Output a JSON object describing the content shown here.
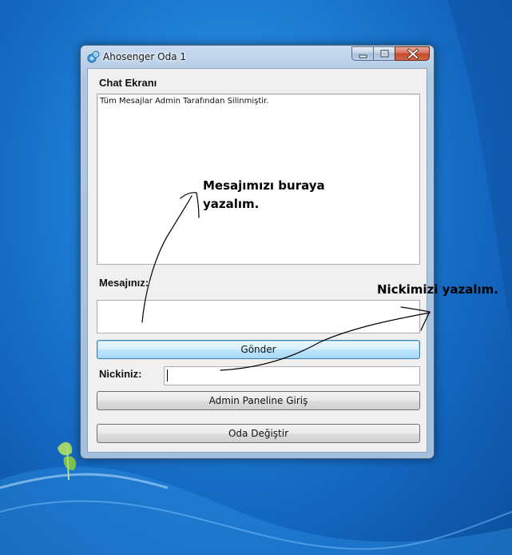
{
  "window": {
    "title": "Ahosenger Oda 1",
    "icon": "messenger-app-icon"
  },
  "chat": {
    "label": "Chat Ekranı",
    "content": "Tüm Mesajlar Admin Tarafından Silinmiştir."
  },
  "message": {
    "label": "Mesajınız:",
    "value": ""
  },
  "send_button": "Gönder",
  "nick": {
    "label": "Nickiniz:",
    "value": ""
  },
  "admin_button": "Admin Paneline Giriş",
  "room_button": "Oda Değiştir",
  "annotations": {
    "message_line1": "Mesajımızı buraya",
    "message_line2": "yazalım.",
    "nick": "Nickimizi yazalım."
  },
  "colors": {
    "desktop": "#1e7fd4",
    "window_frame": "#aec8e4",
    "close_button": "#c44a2e",
    "focused_button": "#3c7fb1"
  }
}
